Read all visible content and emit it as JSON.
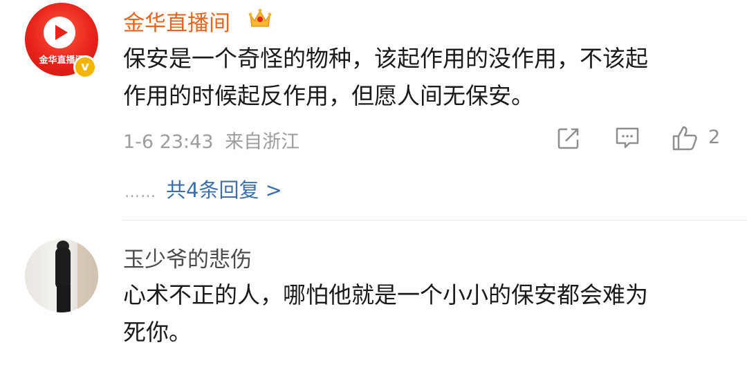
{
  "comments": [
    {
      "username": "金华直播间",
      "avatar_text": "金华直播间",
      "verified_badge": "v",
      "text_lines": [
        "保安是一个奇怪的物种，该起作用的没作用，不该起",
        "作用的时候起反作用，但愿人间无保安。"
      ],
      "time": "1-6 23:43",
      "location": "来自浙江",
      "like_count": "2",
      "replies_dots": "……",
      "replies_link": "共4条回复 >"
    },
    {
      "username": "玉少爷的悲伤",
      "text_lines": [
        "心术不正的人，哪怕他就是一个小小的保安都会难为",
        "死你。"
      ]
    }
  ],
  "icons": {
    "share": "share-icon",
    "comment": "comment-icon",
    "like": "thumbs-up-icon",
    "crown": "crown-icon"
  },
  "colors": {
    "username_vip": "#e8631c",
    "link": "#3d6fa6",
    "meta": "#9c9c9c",
    "badge": "#f5b400"
  }
}
